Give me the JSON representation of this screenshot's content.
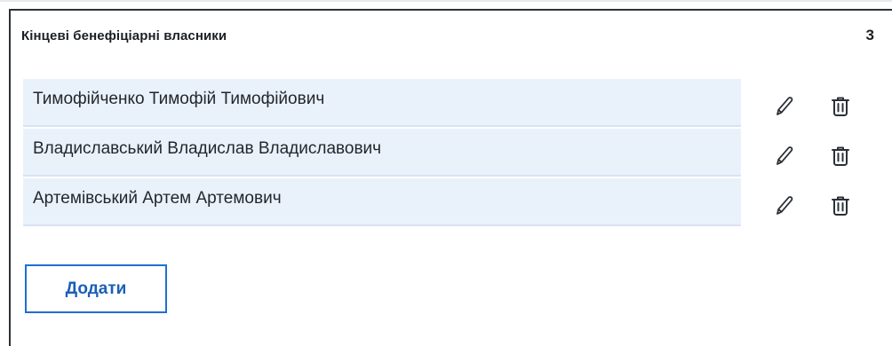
{
  "section": {
    "title": "Кінцеві бенефіціарні власники",
    "count": "3"
  },
  "beneficiaries": [
    {
      "name": "Тимофійченко Тимофій Тимофійович"
    },
    {
      "name": "Владиславський Владислав Владиславович"
    },
    {
      "name": "Артемівський Артем Артемович"
    }
  ],
  "actions": {
    "add_label": "Додати",
    "edit_icon": "pencil-icon",
    "delete_icon": "trash-icon"
  },
  "colors": {
    "accent": "#1f6fd1",
    "row_background": "#e9f2fb",
    "text": "#1f2329"
  }
}
